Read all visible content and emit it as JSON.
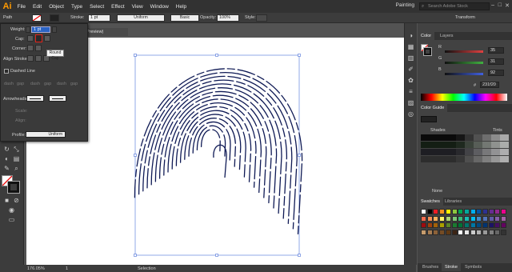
{
  "app": {
    "logo": "Ai",
    "menus": [
      "File",
      "Edit",
      "Object",
      "Type",
      "Select",
      "Effect",
      "View",
      "Window",
      "Help"
    ],
    "workspace": "Painting",
    "search_placeholder": "Search Adobe Stock"
  },
  "control_bar": {
    "selection": "Path",
    "stroke_label": "Stroke:",
    "stroke_value": "1 pt",
    "uniform_label": "Uniform",
    "basic_label": "Basic",
    "opacity_label": "Opacity:",
    "opacity_value": "100%",
    "style_label": "Style:",
    "transform_label": "Transform"
  },
  "document_tab": {
    "title": "Preview)"
  },
  "stroke_panel": {
    "weight_label": "Weight:",
    "weight_value": "1 pt",
    "cap_label": "Cap:",
    "corner_label": "Corner:",
    "align_label": "Align Stroke:",
    "dashed_label": "Dashed Line",
    "dash_labels": [
      "dash",
      "gap",
      "dash",
      "gap",
      "dash",
      "gap"
    ],
    "arrowheads_label": "Arrowheads:",
    "scale_label": "Scale:",
    "align2_label": "Align:",
    "profile_label": "Profile:",
    "profile_value": "Uniform",
    "tooltip": "Round Cap"
  },
  "status_bar": {
    "zoom": "176.05%",
    "page": "1",
    "tool": "Selection"
  },
  "color_panel": {
    "tabs": [
      "Color",
      "Layers"
    ],
    "channels": [
      {
        "name": "R",
        "value": "35",
        "color": "#e04040"
      },
      {
        "name": "G",
        "value": "31",
        "color": "#40b040"
      },
      {
        "name": "B",
        "value": "92",
        "color": "#4060e0"
      }
    ],
    "hex_label": "#",
    "hex_value": "231f20"
  },
  "color_guide_panel": {
    "tab": "Color Guide",
    "col1": "Shades",
    "col2": "Tints",
    "footer": "None"
  },
  "swatches_panel": {
    "tabs": [
      "Swatches",
      "Libraries"
    ]
  },
  "bottom_tabs": [
    "Brushes",
    "Stroke",
    "Symbols"
  ],
  "icons": [
    "close-icon",
    "minimize-icon",
    "maximize-icon",
    "search-icon",
    "fill-icon",
    "stroke-icon",
    "eyedropper-icon"
  ]
}
